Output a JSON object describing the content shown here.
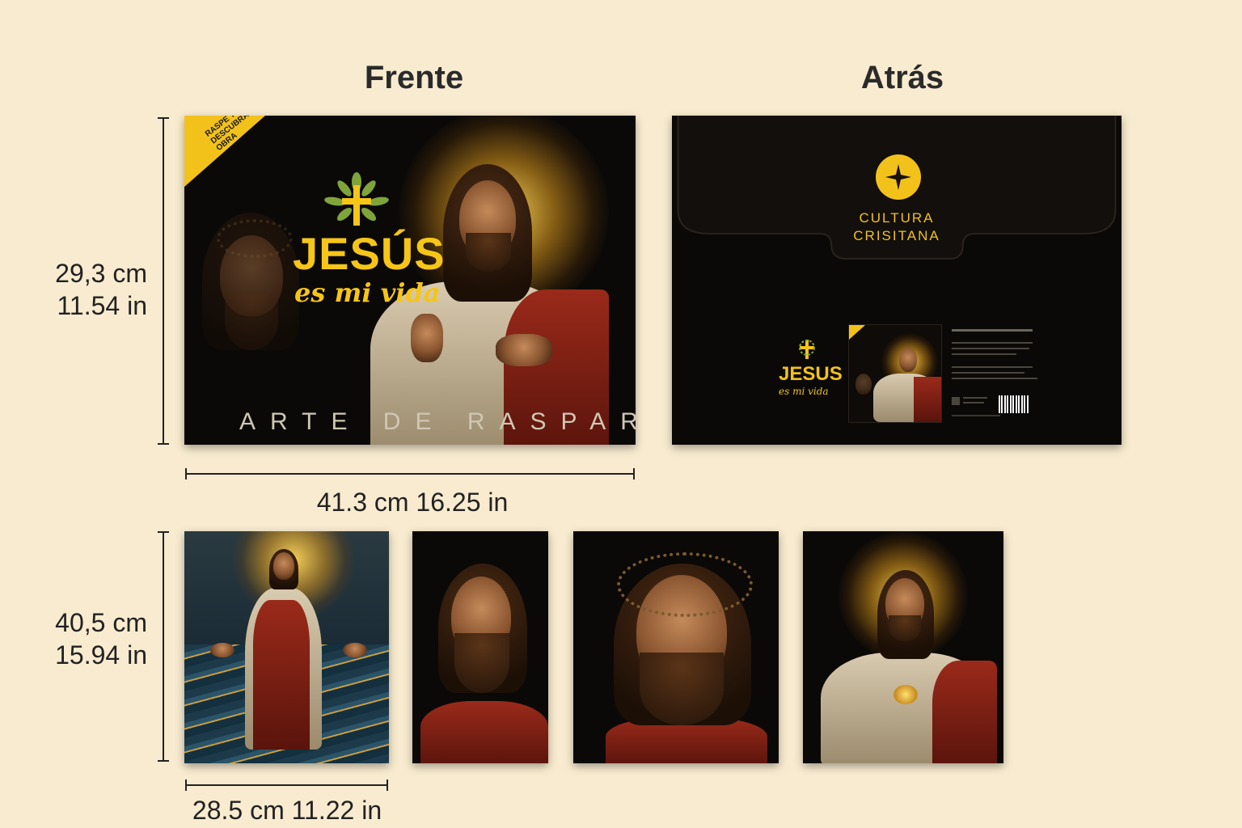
{
  "headings": {
    "front": "Frente",
    "back": "Atrás"
  },
  "front_card": {
    "title": "JESÚS",
    "subtitle": "es mi vida",
    "footer": "ARTE DE RASPAR",
    "ribbon_text": "RASPE Y DESCUBRA SU OBRA",
    "accent_color": "#f5c518"
  },
  "back_card": {
    "brand_line1": "CULTURA",
    "brand_line2": "CRISITANA",
    "mini_title": "JESUS",
    "mini_subtitle": "es mi vida",
    "accent_color": "#f2c21b"
  },
  "dimensions": {
    "cover_height_cm": "29,3 cm",
    "cover_height_in": "11.54 in",
    "cover_width": "41.3 cm 16.25 in",
    "print_height_cm": "40,5 cm",
    "print_height_in": "15.94 in",
    "print_width": "28.5 cm 11.22 in"
  },
  "prints": [
    {
      "subject": "jesus-walking-on-water"
    },
    {
      "subject": "jesus-looking-up"
    },
    {
      "subject": "jesus-crown-of-thorns"
    },
    {
      "subject": "sacred-heart-jesus"
    }
  ]
}
